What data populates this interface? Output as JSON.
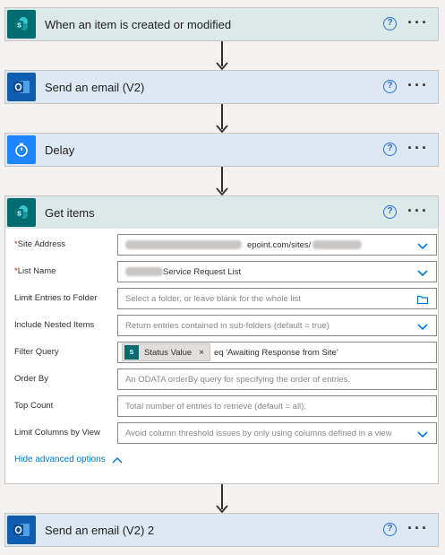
{
  "colors": {
    "sharepoint_header": "#dbe9e8",
    "outlook_header": "#dce9f5",
    "sharepoint_icon": "#036c70",
    "outlook_icon": "#0f5db0",
    "delay_icon": "#1f85ff",
    "link_blue": "#0078d4"
  },
  "steps": {
    "trigger": {
      "title": "When an item is created or modified",
      "icon": "sharepoint-icon"
    },
    "email1": {
      "title": "Send an email (V2)",
      "icon": "outlook-icon"
    },
    "delay": {
      "title": "Delay",
      "icon": "timer-icon"
    },
    "get_items": {
      "title": "Get items",
      "icon": "sharepoint-icon"
    },
    "email2": {
      "title": "Send an email (V2) 2",
      "icon": "outlook-icon"
    }
  },
  "common": {
    "help": "?",
    "more": "···"
  },
  "form": {
    "site_address": {
      "label": "Site Address",
      "required_mark": "*",
      "value_visible": "epoint.com/sites/"
    },
    "list_name": {
      "label": "List Name",
      "required_mark": "*",
      "value_visible": "Service Request List"
    },
    "limit_folder": {
      "label": "Limit Entries to Folder",
      "placeholder": "Select a folder, or leave blank for the whole list"
    },
    "nested_items": {
      "label": "Include Nested Items",
      "placeholder": "Return entries contained in sub-folders (default = true)"
    },
    "filter_query": {
      "label": "Filter Query",
      "token": "Status Value",
      "token_close": "×",
      "suffix": "eq 'Awaiting Response from Site'"
    },
    "order_by": {
      "label": "Order By",
      "placeholder": "An ODATA orderBy query for specifying the order of entries."
    },
    "top_count": {
      "label": "Top Count",
      "placeholder": "Total number of entries to retrieve (default = all)."
    },
    "limit_columns": {
      "label": "Limit Columns by View",
      "placeholder": "Avoid column threshold issues by only using columns defined in a view"
    },
    "advanced_link": "Hide advanced options"
  }
}
